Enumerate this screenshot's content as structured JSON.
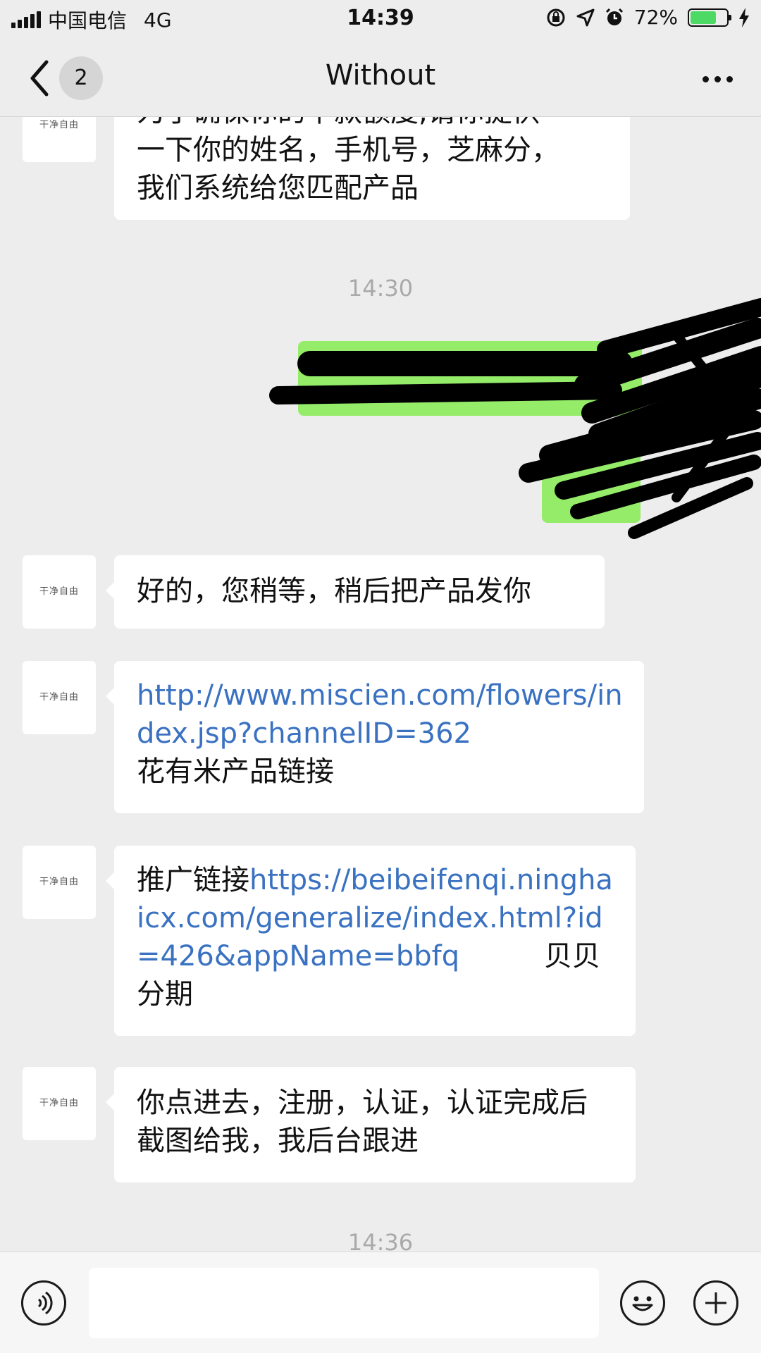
{
  "status_bar": {
    "carrier": "中国电信",
    "network": "4G",
    "time": "14:39",
    "battery_percent": "72%",
    "battery_level": 0.72
  },
  "nav": {
    "unread_badge": "2",
    "title": "Without",
    "more_icon": "more-dots-icon",
    "back_icon": "chevron-left-icon"
  },
  "messages": {
    "m0_line1": "为了确保你的下款额度,请你提供",
    "m0_line2": "一下你的姓名，手机号，芝麻分，",
    "m0_line3": "我们系统给您匹配产品",
    "ts1": "14:30",
    "m3_text": "好的，您稍等，稍后把产品发你",
    "m4_link": "http://www.miscien.com/flowers/index.jsp?channelID=362",
    "m4_text": "花有米产品链接",
    "m5_prefix": "推广链接",
    "m5_link": "https://beibeifenqi.ninghaicx.com/generalize/index.html?id=426&appName=bbfq",
    "m5_suffix": "贝贝分期",
    "m6_text": "你点进去，注册，认证，认证完成后截图给我，我后台跟进",
    "ts2": "14:36",
    "avatar_label": "干净自由"
  },
  "input_bar": {
    "voice_icon": "voice-icon",
    "emoji_icon": "emoji-icon",
    "plus_icon": "plus-icon",
    "placeholder": ""
  },
  "colors": {
    "background": "#ededed",
    "sent_bubble": "#95ec69",
    "received_bubble": "#ffffff",
    "link": "#3a72c1",
    "battery_fill": "#4cd964"
  }
}
